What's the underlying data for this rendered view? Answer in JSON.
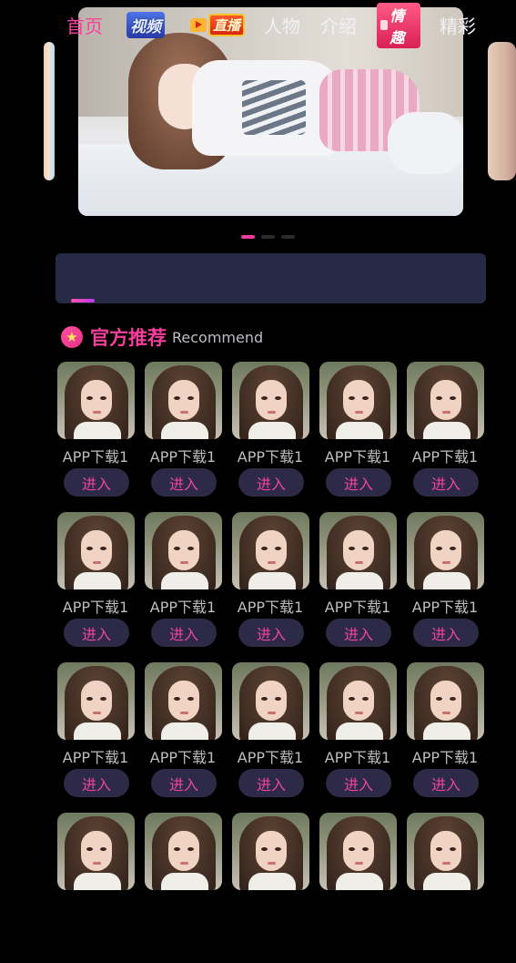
{
  "banner": {
    "image_alt": "",
    "pagination": {
      "count": 3,
      "active_index": 0
    }
  },
  "nav": {
    "items": [
      {
        "label": "首页",
        "style": "text",
        "active": true
      },
      {
        "label": "视频",
        "style": "badge-video"
      },
      {
        "label": "直播",
        "style": "badge-live"
      },
      {
        "label": "人物",
        "style": "text"
      },
      {
        "label": "介绍",
        "style": "text"
      },
      {
        "label": "情趣",
        "style": "badge-fun"
      },
      {
        "label": "精彩",
        "style": "text"
      }
    ]
  },
  "section": {
    "title": "官方推荐",
    "subtitle": "Recommend",
    "icon": "star-icon"
  },
  "apps": {
    "rows": [
      [
        {
          "name": "APP下载1",
          "button": "进入"
        },
        {
          "name": "APP下载1",
          "button": "进入"
        },
        {
          "name": "APP下载1",
          "button": "进入"
        },
        {
          "name": "APP下载1",
          "button": "进入"
        },
        {
          "name": "APP下载1",
          "button": "进入"
        }
      ],
      [
        {
          "name": "APP下载1",
          "button": "进入"
        },
        {
          "name": "APP下载1",
          "button": "进入"
        },
        {
          "name": "APP下载1",
          "button": "进入"
        },
        {
          "name": "APP下载1",
          "button": "进入"
        },
        {
          "name": "APP下载1",
          "button": "进入"
        }
      ],
      [
        {
          "name": "APP下载1",
          "button": "进入"
        },
        {
          "name": "APP下载1",
          "button": "进入"
        },
        {
          "name": "APP下载1",
          "button": "进入"
        },
        {
          "name": "APP下载1",
          "button": "进入"
        },
        {
          "name": "APP下载1",
          "button": "进入"
        }
      ],
      [
        {
          "name": "",
          "button": ""
        },
        {
          "name": "",
          "button": ""
        },
        {
          "name": "",
          "button": ""
        },
        {
          "name": "",
          "button": ""
        },
        {
          "name": "",
          "button": ""
        }
      ]
    ]
  },
  "colors": {
    "background": "#000000",
    "accent_pink": "#f63e9c",
    "nav_bg": "#262a44",
    "button_bg": "#2d2a48"
  }
}
